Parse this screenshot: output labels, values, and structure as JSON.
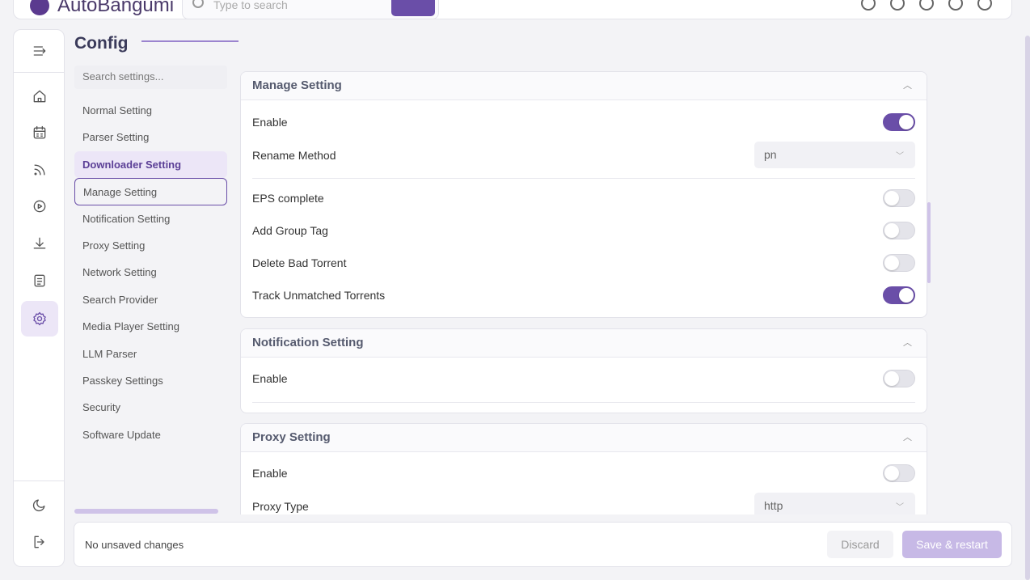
{
  "app": {
    "name": "AutoBangumi",
    "search_placeholder": "Type to search"
  },
  "page": {
    "title": "Config"
  },
  "nav": {
    "search_placeholder": "Search settings...",
    "items": [
      {
        "label": "Normal Setting"
      },
      {
        "label": "Parser Setting"
      },
      {
        "label": "Downloader Setting"
      },
      {
        "label": "Manage Setting"
      },
      {
        "label": "Notification Setting"
      },
      {
        "label": "Proxy Setting"
      },
      {
        "label": "Network Setting"
      },
      {
        "label": "Search Provider"
      },
      {
        "label": "Media Player Setting"
      },
      {
        "label": "LLM Parser"
      },
      {
        "label": "Passkey Settings"
      },
      {
        "label": "Security"
      },
      {
        "label": "Software Update"
      }
    ],
    "active_index": 2,
    "hover_index": 3
  },
  "sections": {
    "manage": {
      "title": "Manage Setting",
      "enable_label": "Enable",
      "enable_on": true,
      "rename_label": "Rename Method",
      "rename_value": "pn",
      "eps_label": "EPS complete",
      "eps_on": false,
      "group_tag_label": "Add Group Tag",
      "group_tag_on": false,
      "delete_bad_label": "Delete Bad Torrent",
      "delete_bad_on": false,
      "track_label": "Track Unmatched Torrents",
      "track_on": true
    },
    "notification": {
      "title": "Notification Setting",
      "enable_label": "Enable",
      "enable_on": false
    },
    "proxy": {
      "title": "Proxy Setting",
      "enable_label": "Enable",
      "enable_on": false,
      "type_label": "Proxy Type",
      "type_value": "http"
    }
  },
  "footer": {
    "status": "No unsaved changes",
    "discard_label": "Discard",
    "save_label": "Save & restart"
  },
  "colors": {
    "accent": "#6a4ea8",
    "accent_light": "#ece6f7"
  }
}
